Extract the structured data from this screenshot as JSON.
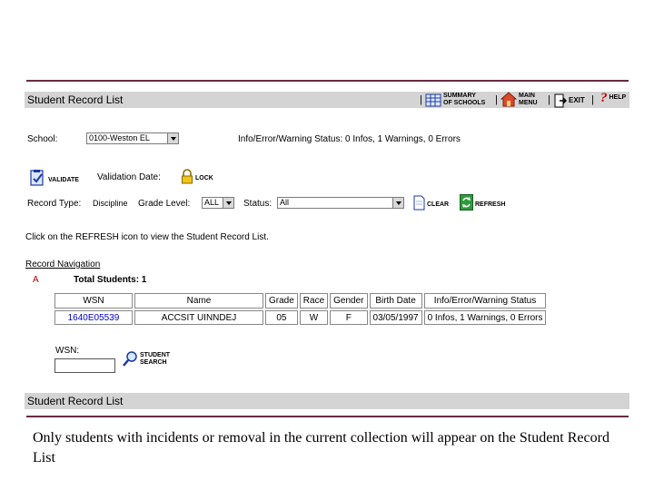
{
  "header": {
    "title": "Student Record List",
    "summary_label_1": "SUMMARY",
    "summary_label_2": "OF SCHOOLS",
    "main_label_1": "MAIN",
    "main_label_2": "MENU",
    "exit_label": "EXIT",
    "help_label": "HELP",
    "help_glyph": "?"
  },
  "filters": {
    "school_label": "School:",
    "school_value": "0100-Weston EL",
    "status_text": "Info/Error/Warning Status: 0 Infos, 1 Warnings, 0 Errors",
    "validate_label": "VALIDATE",
    "validation_date_label": "Validation Date:",
    "lock_label": "LOCK",
    "record_type_label": "Record Type:",
    "record_type_value": "Discipline",
    "grade_level_label": "Grade Level:",
    "grade_level_value": "ALL",
    "status_label": "Status:",
    "status_value": "All",
    "clear_label": "CLEAR",
    "refresh_label": "REFRESH"
  },
  "instruction": "Click on the REFRESH icon to view the Student Record List.",
  "navigation": {
    "title": "Record Navigation",
    "letter": "A",
    "total_label": "Total Students: 1"
  },
  "table": {
    "headers": [
      "WSN",
      "Name",
      "Grade",
      "Race",
      "Gender",
      "Birth Date",
      "Info/Error/Warning Status"
    ],
    "rows": [
      [
        "1640E05539",
        "ACCSIT UINNDEJ",
        "05",
        "W",
        "F",
        "03/05/1997",
        "0 Infos, 1 Warnings, 0 Errors"
      ]
    ]
  },
  "search": {
    "wsn_label": "WSN:",
    "wsn_value": "",
    "button_label_1": "STUDENT",
    "button_label_2": "SEARCH"
  },
  "footer_bar": {
    "title": "Student Record List"
  },
  "caption": "Only students with incidents or removal in the current collection will appear on the Student Record List",
  "colors": {
    "rule": "#6b2a3f",
    "bar": "#d4d4d4",
    "link_blue": "#0000cc",
    "nav_letter": "#aa0000"
  }
}
